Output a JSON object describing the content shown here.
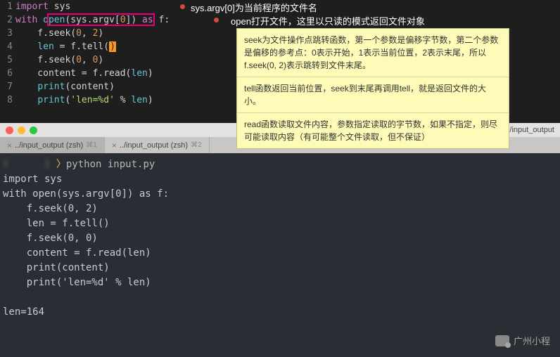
{
  "editor": {
    "lines": [
      {
        "n": "1",
        "segs": [
          [
            "kw",
            "import"
          ],
          [
            "punc",
            " "
          ],
          [
            "ident",
            "sys"
          ]
        ]
      },
      {
        "n": "2",
        "segs": [
          [
            "kw",
            "with"
          ],
          [
            "punc",
            " "
          ],
          [
            "fn",
            "open"
          ],
          [
            "punc",
            "(sys.argv["
          ],
          [
            "num",
            "0"
          ],
          [
            "punc",
            "])"
          ],
          [
            "punc",
            " "
          ],
          [
            "kw",
            "as"
          ],
          [
            "punc",
            " f:"
          ]
        ]
      },
      {
        "n": "3",
        "segs": [
          [
            "punc",
            "    f.seek("
          ],
          [
            "num",
            "0"
          ],
          [
            "punc",
            ", "
          ],
          [
            "num",
            "2"
          ],
          [
            "punc",
            ")"
          ]
        ]
      },
      {
        "n": "4",
        "segs": [
          [
            "punc",
            "    "
          ],
          [
            "fn",
            "len"
          ],
          [
            "punc",
            " = f.tell("
          ],
          [
            "cursor",
            ")"
          ]
        ]
      },
      {
        "n": "5",
        "segs": [
          [
            "punc",
            "    f.seek("
          ],
          [
            "num",
            "0"
          ],
          [
            "punc",
            ", "
          ],
          [
            "num",
            "0"
          ],
          [
            "punc",
            ")"
          ]
        ]
      },
      {
        "n": "6",
        "segs": [
          [
            "punc",
            "    content = f.read("
          ],
          [
            "fn",
            "len"
          ],
          [
            "punc",
            ")"
          ]
        ]
      },
      {
        "n": "7",
        "segs": [
          [
            "punc",
            "    "
          ],
          [
            "fn",
            "print"
          ],
          [
            "punc",
            "(content)"
          ]
        ]
      },
      {
        "n": "8",
        "segs": [
          [
            "punc",
            "    "
          ],
          [
            "fn",
            "print"
          ],
          [
            "punc",
            "("
          ],
          [
            "str",
            "'len=%d'"
          ],
          [
            "punc",
            " % "
          ],
          [
            "fn",
            "len"
          ],
          [
            "punc",
            ")"
          ]
        ]
      }
    ]
  },
  "annotations": {
    "a1": "sys.argv[0]为当前程序的文件名",
    "a2": "open打开文件，这里以只读的模式返回文件对象"
  },
  "note": {
    "p1": "seek为文件操作点跳转函数，第一个参数是偏移字节数，第二个参数是偏移的参考点：0表示开始，1表示当前位置，2表示末尾，所以f.seek(0, 2)表示跳转到文件末尾。",
    "p2": "tell函数返回当前位置，seek到末尾再调用tell，就是返回文件的大小。",
    "p3": "read函数读取文件内容，参数指定读取的字节数，如果不指定，则尽可能读取内容（有可能整个文件读取，但不保证）"
  },
  "terminal": {
    "titlebar": "ing/input_output",
    "tabs": [
      {
        "label": "../input_output (zsh)",
        "shortcut": "⌘1"
      },
      {
        "label": "../input_output (zsh)",
        "shortcut": "⌘2"
      }
    ],
    "prompt_path": "(      )",
    "prompt_sym": " 〉",
    "prompt_cmd": "python input.py",
    "out": [
      "import sys",
      "with open(sys.argv[0]) as f:",
      "    f.seek(0, 2)",
      "    len = f.tell()",
      "    f.seek(0, 0)",
      "    content = f.read(len)",
      "    print(content)",
      "    print('len=%d' % len)",
      "",
      "len=164"
    ]
  },
  "watermark": "广州小程"
}
